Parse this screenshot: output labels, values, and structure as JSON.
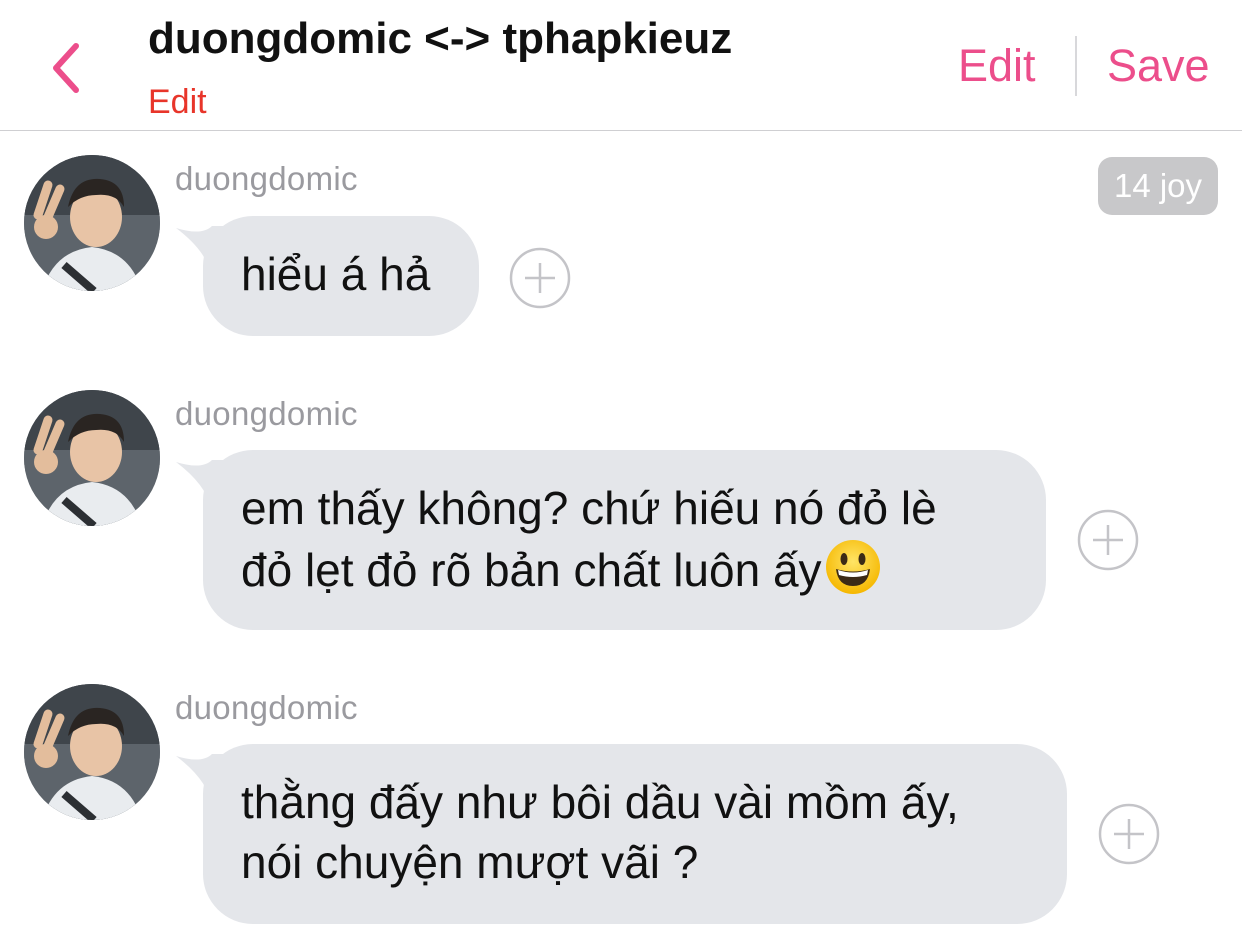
{
  "header": {
    "title": "duongdomic <-> tphapkieuz",
    "subtitle": "Edit",
    "edit_label": "Edit",
    "save_label": "Save"
  },
  "time_badge": "14 joy",
  "colors": {
    "accent": "#ec4e8b",
    "subtitle": "#e8352a",
    "bubble": "#e4e6ea",
    "badge": "#c8c8ca"
  },
  "messages": [
    {
      "sender": "duongdomic",
      "lines": [
        "hiểu á hả"
      ]
    },
    {
      "sender": "duongdomic",
      "lines": [
        "em thấy không? chứ hiếu nó đỏ lè",
        "đỏ lẹt đỏ rõ bản chất luôn ấy"
      ],
      "emoji": "grinning-face"
    },
    {
      "sender": "duongdomic",
      "lines": [
        "thằng đấy như bôi dầu vài mồm ấy,",
        "nói chuyện mượt vãi ?"
      ]
    }
  ]
}
